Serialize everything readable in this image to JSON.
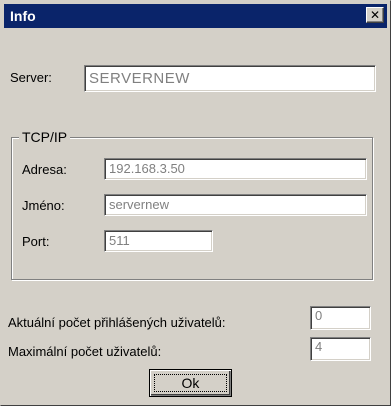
{
  "window": {
    "title": "Info",
    "close_glyph": "✕",
    "close_icon": "close-icon"
  },
  "server": {
    "label": "Server:",
    "value": "SERVERNEW"
  },
  "tcpip": {
    "legend": "TCP/IP",
    "address_label": "Adresa:",
    "address_value": "192.168.3.50",
    "name_label": "Jméno:",
    "name_value": "servernew",
    "port_label": "Port:",
    "port_value": "511"
  },
  "users": {
    "current_label": "Aktuální počet přihlášených uživatelů:",
    "current_value": "0",
    "max_label": "Maximální počet uživatelů:",
    "max_value": "4"
  },
  "buttons": {
    "ok_label": "Ok"
  },
  "colors": {
    "titlebar": "#0a246a",
    "face": "#d4d0c8",
    "disabled_text": "#808080"
  }
}
